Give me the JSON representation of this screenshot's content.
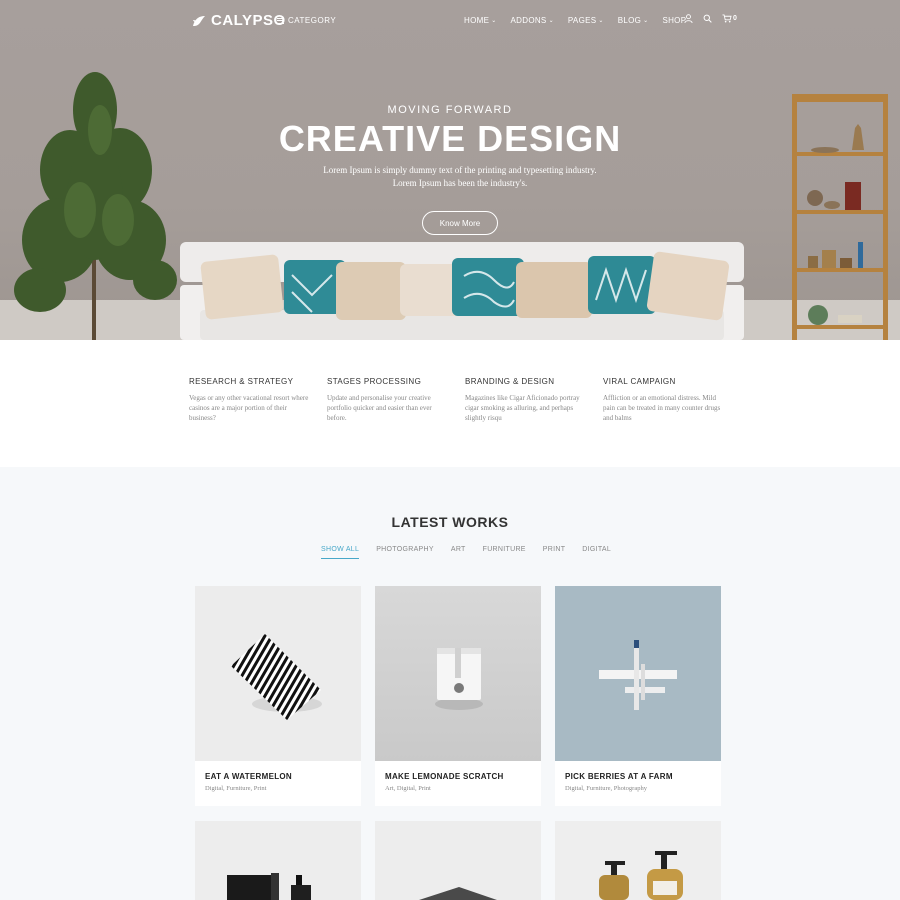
{
  "nav": {
    "logo": "CALYPSO",
    "category": "CATEGORY",
    "menu": [
      {
        "label": "HOME",
        "has_dropdown": true
      },
      {
        "label": "ADDONS",
        "has_dropdown": true
      },
      {
        "label": "PAGES",
        "has_dropdown": true
      },
      {
        "label": "BLOG",
        "has_dropdown": true
      },
      {
        "label": "SHOP",
        "has_dropdown": false
      }
    ],
    "cart_count": "0",
    "icons": [
      "user-icon",
      "search-icon",
      "cart-icon"
    ]
  },
  "hero": {
    "subtitle": "MOVING FORWARD",
    "title": "CREATIVE DESIGN",
    "desc_line1": "Lorem Ipsum is simply dummy text of the printing and typesetting industry.",
    "desc_line2": "Lorem Ipsum has been the industry's.",
    "button": "Know More"
  },
  "features": [
    {
      "title": "RESEARCH & STRATEGY",
      "text": "Vegas or any other vacational resort where casinos are a major portion of their business?"
    },
    {
      "title": "STAGES PROCESSING",
      "text": "Update and personalise your creative portfolio quicker and easier than ever before."
    },
    {
      "title": "BRANDING & DESIGN",
      "text": "Magazines like Cigar Aficionado portray cigar smoking as alluring, and perhaps slightly risqu"
    },
    {
      "title": "VIRAL CAMPAIGN",
      "text": "Affliction or an emotional distress. Mild pain can be treated in many counter drugs and balms"
    }
  ],
  "works": {
    "title": "LATEST WORKS",
    "filters": [
      "SHOW ALL",
      "PHOTOGRAPHY",
      "ART",
      "FURNITURE",
      "PRINT",
      "DIGITAL"
    ],
    "active_filter": "SHOW ALL",
    "items": [
      {
        "name": "EAT A WATERMELON",
        "tags": "Digital, Furniture, Print"
      },
      {
        "name": "MAKE LEMONADE SCRATCH",
        "tags": "Art, Digital, Print"
      },
      {
        "name": "PICK BERRIES AT A FARM",
        "tags": "Digital, Furniture, Photography"
      },
      {
        "name": "",
        "tags": ""
      },
      {
        "name": "",
        "tags": ""
      },
      {
        "name": "",
        "tags": ""
      }
    ]
  },
  "colors": {
    "accent": "#48a8c9",
    "hero_bg": "#a59d99",
    "section_bg": "#f6f8fa"
  }
}
